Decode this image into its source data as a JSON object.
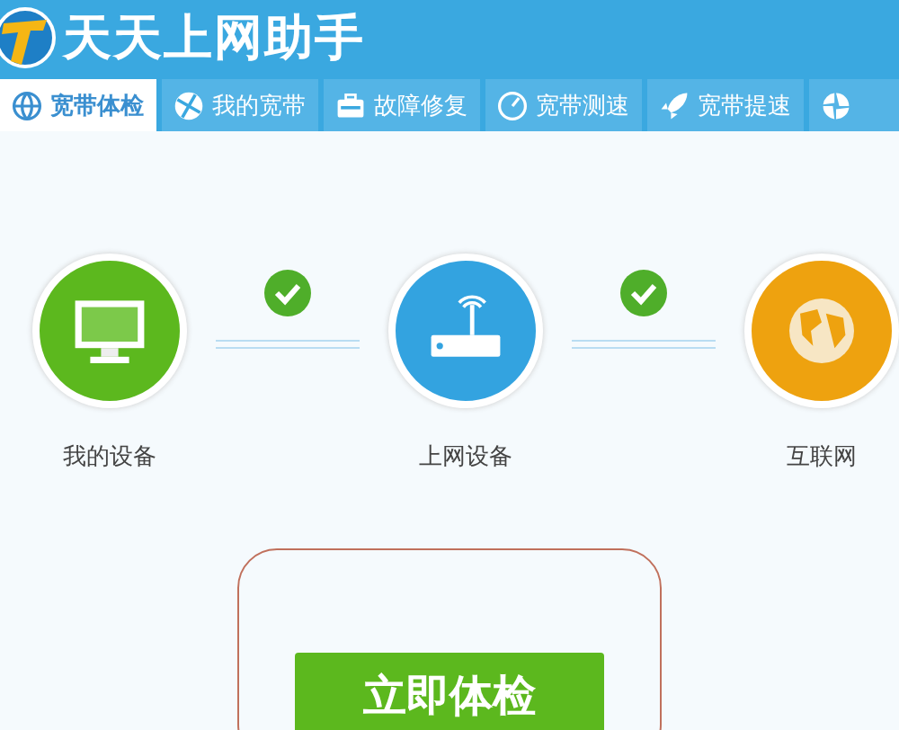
{
  "app": {
    "title": "天天上网助手"
  },
  "tabs": [
    {
      "kind": "globe",
      "label": "宽带体检",
      "selected": true
    },
    {
      "kind": "ball",
      "label": "我的宽带",
      "selected": false
    },
    {
      "kind": "toolbox",
      "label": "故障修复",
      "selected": false
    },
    {
      "kind": "gauge",
      "label": "宽带测速",
      "selected": false
    },
    {
      "kind": "rocket",
      "label": "宽带提速",
      "selected": false
    },
    {
      "kind": "aperture",
      "selected": false
    }
  ],
  "devices": [
    {
      "kind": "monitor",
      "label": "我的设备",
      "color": "#5cb81e"
    },
    {
      "kind": "router",
      "label": "上网设备",
      "color": "#33a3e0"
    },
    {
      "kind": "globe",
      "label": "互联网",
      "color": "#eea20f"
    }
  ],
  "links": [
    {
      "checked": true
    },
    {
      "checked": true
    }
  ],
  "check_button": {
    "label": "立即体检"
  }
}
